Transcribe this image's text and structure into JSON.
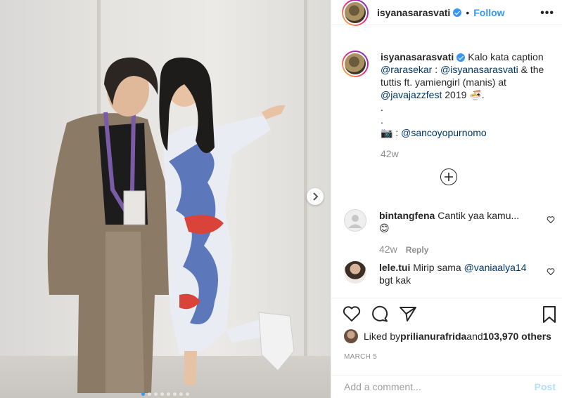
{
  "post": {
    "username": "isyanasarasvati",
    "verified": true,
    "bullet": "•",
    "follow_label": "Follow",
    "more_icon": "more-options-icon",
    "photo_alt": "Two women posing against a white wall",
    "carousel": {
      "count": 8,
      "active_index": 0
    },
    "caption": {
      "username": "isyanasarasvati",
      "text_1": " Kalo kata caption ",
      "mention_1": "@rarasekar",
      "text_2": " : ",
      "mention_2": "@isyanasarasvati",
      "text_3": " & the tuttis ft. yamiengirl (manis) at ",
      "mention_3": "@javajazzfest",
      "text_4": " 2019 ",
      "emoji": "🍜.",
      "dot_1": ".",
      "dot_2": ".",
      "camera_emoji": "📷",
      "text_5": " : ",
      "mention_4": "@sancoyopurnomo",
      "time": "42w"
    },
    "comments": [
      {
        "username": "bintangfena",
        "text": " Cantik yaa kamu...😊",
        "time": "42w",
        "reply_label": "Reply"
      },
      {
        "username": "lele.tui",
        "text_1": " Mirip sama ",
        "mention": "@vaniaalya14",
        "text_2": " bgt kak"
      }
    ],
    "likes": {
      "prefix": "Liked by ",
      "liker": "prilianurafrida",
      "middle": " and ",
      "count": "103,970 others"
    },
    "date": "MARCH 5",
    "add_comment": {
      "placeholder": "Add a comment...",
      "post_label": "Post"
    },
    "colors": {
      "accent": "#3897f0",
      "link": "#003569",
      "muted": "#8e8e8e",
      "post_disabled": "#b2dffc"
    }
  }
}
